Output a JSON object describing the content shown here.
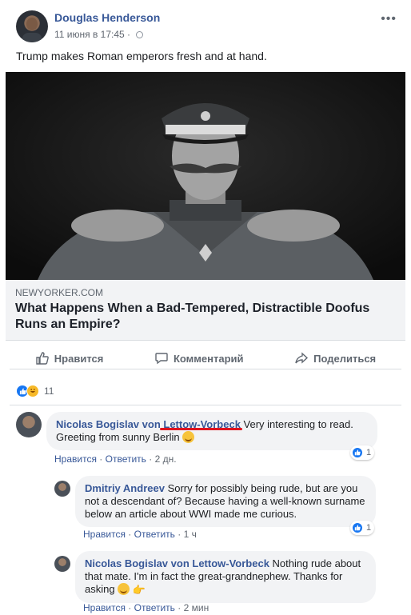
{
  "post": {
    "author": "Douglas Henderson",
    "timestamp": "11 июня в 17:45",
    "privacy_icon": "globe-icon",
    "more_icon": "more-options-icon",
    "text": "Trump makes Roman emperors fresh and at hand."
  },
  "link": {
    "domain": "NEWYORKER.COM",
    "title": "What Happens When a Bad-Tempered, Distractible Doofus Runs an Empire?"
  },
  "actions": {
    "like": "Нравится",
    "comment": "Комментарий",
    "share": "Поделиться"
  },
  "reactions": {
    "count": "11",
    "icons": [
      "like-icon",
      "haha-icon"
    ]
  },
  "comments": [
    {
      "author": "Nicolas Bogislav von Lettow-Vorbeck",
      "text": "Very interesting to read. Greeting from sunny Berlin",
      "emoji": "smile-icon",
      "like_label": "Нравится",
      "reply_label": "Ответить",
      "time": "2 дн.",
      "reaction_count": "1"
    },
    {
      "author": "Dmitriy Andreev",
      "text": "Sorry for possibly being rude, but are you not a descendant of? Because having a well-known surname below an article about WWI made me curious.",
      "like_label": "Нравится",
      "reply_label": "Ответить",
      "time": "1 ч",
      "reaction_count": "1"
    },
    {
      "author": "Nicolas Bogislav von Lettow-Vorbeck",
      "text": "Nothing rude about that mate. I'm in fact the great-grandnephew. Thanks for asking",
      "emoji": "laugh-icon",
      "emoji2": "point-icon",
      "like_label": "Нравится",
      "reply_label": "Ответить",
      "time": "2 мин"
    }
  ],
  "colors": {
    "link": "#385898",
    "brand": "#1877f2",
    "highlight": "#e0141f"
  },
  "separator": "·"
}
